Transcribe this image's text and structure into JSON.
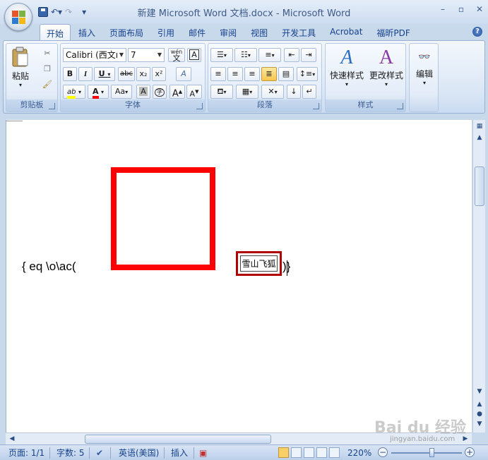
{
  "window": {
    "title": "新建 Microsoft Word 文档.docx - Microsoft Word",
    "minimize": "–",
    "restore": "▫",
    "close": "✕"
  },
  "qat": {
    "undo": "↶▾",
    "redo": "↷",
    "customize": "▾"
  },
  "tabs": [
    "开始",
    "插入",
    "页面布局",
    "引用",
    "邮件",
    "审阅",
    "视图",
    "开发工具",
    "Acrobat",
    "福昕PDF"
  ],
  "ribbon": {
    "clipboard": {
      "label": "剪贴板",
      "paste": "粘贴"
    },
    "font": {
      "label": "字体",
      "font_name": "Calibri (西文ı",
      "font_size": "7",
      "wen": "wén",
      "wen_char": "文",
      "char_border": "A",
      "bold": "B",
      "italic": "I",
      "underline": "U",
      "strike": "abc",
      "subscript": "x₂",
      "superscript": "x²",
      "clear": "A",
      "highlight": "ab",
      "font_color": "A",
      "change_case": "Aa",
      "char_shade": "A",
      "enclose": "字",
      "grow": "A",
      "shrink": "A"
    },
    "paragraph": {
      "label": "段落"
    },
    "styles": {
      "label": "样式",
      "quick_styles": "快速样式",
      "change_styles": "更改样式"
    },
    "editing": {
      "label": "编辑"
    }
  },
  "document": {
    "field_code_open": "{ eq \\o\\ac(",
    "box_text": "雪山飞狐",
    "field_code_close": ")}"
  },
  "status": {
    "page": "页面: 1/1",
    "words": "字数: 5",
    "language": "英语(美国)",
    "insert_mode": "插入",
    "zoom": "220%"
  },
  "watermark": {
    "brand": "Bai du 经验",
    "url": "jingyan.baidu.com"
  },
  "colors": {
    "highlight_yellow": "#ffff00",
    "font_color_red": "#ff0000",
    "box_red": "#ff0000"
  }
}
